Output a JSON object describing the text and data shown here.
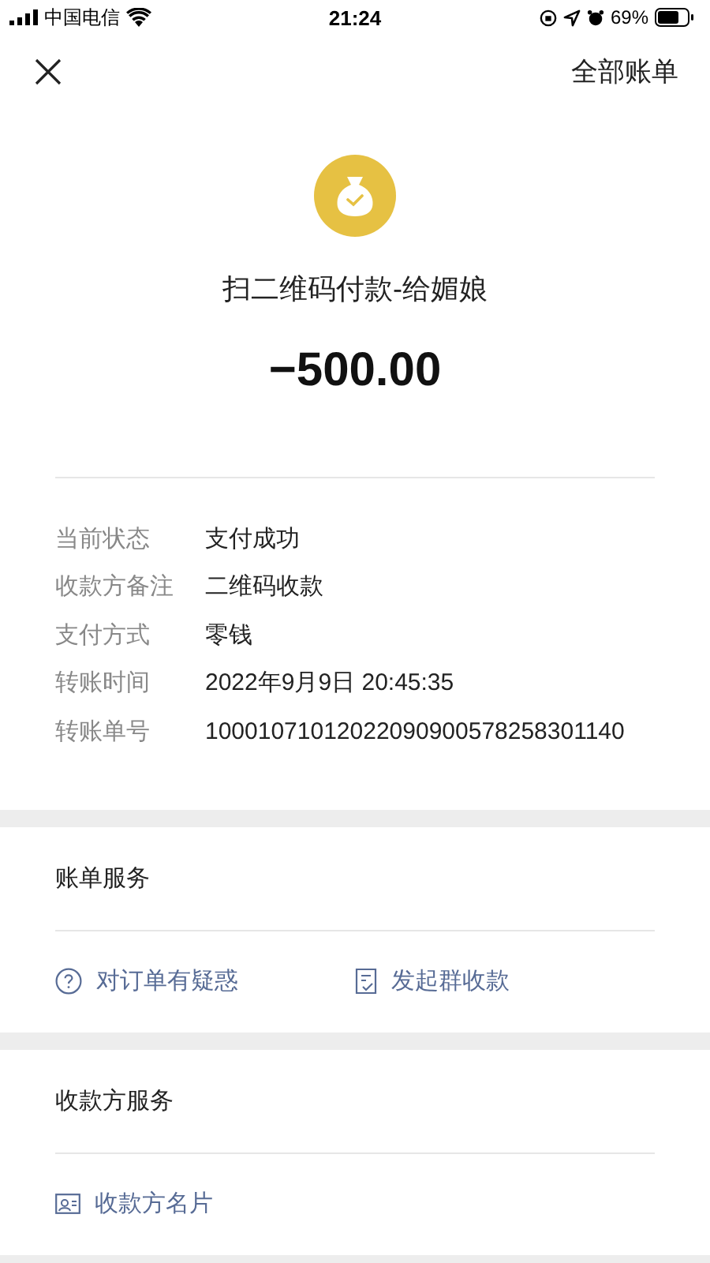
{
  "status_bar": {
    "carrier": "中国电信",
    "time": "21:24",
    "battery": "69%"
  },
  "nav": {
    "link": "全部账单"
  },
  "header": {
    "title": "扫二维码付款-给媚娘",
    "amount": "−500.00"
  },
  "details": [
    {
      "label": "当前状态",
      "value": "支付成功"
    },
    {
      "label": "收款方备注",
      "value": "二维码收款"
    },
    {
      "label": "支付方式",
      "value": "零钱"
    },
    {
      "label": "转账时间",
      "value": "2022年9月9日 20:45:35"
    },
    {
      "label": "转账单号",
      "value": "10001071012022090900578258301140"
    }
  ],
  "sections": [
    {
      "title": "账单服务",
      "actions": [
        {
          "label": "对订单有疑惑",
          "kind": "question"
        },
        {
          "label": "发起群收款",
          "kind": "receipt"
        }
      ]
    },
    {
      "title": "收款方服务",
      "actions": [
        {
          "label": "收款方名片",
          "kind": "card"
        }
      ]
    }
  ]
}
